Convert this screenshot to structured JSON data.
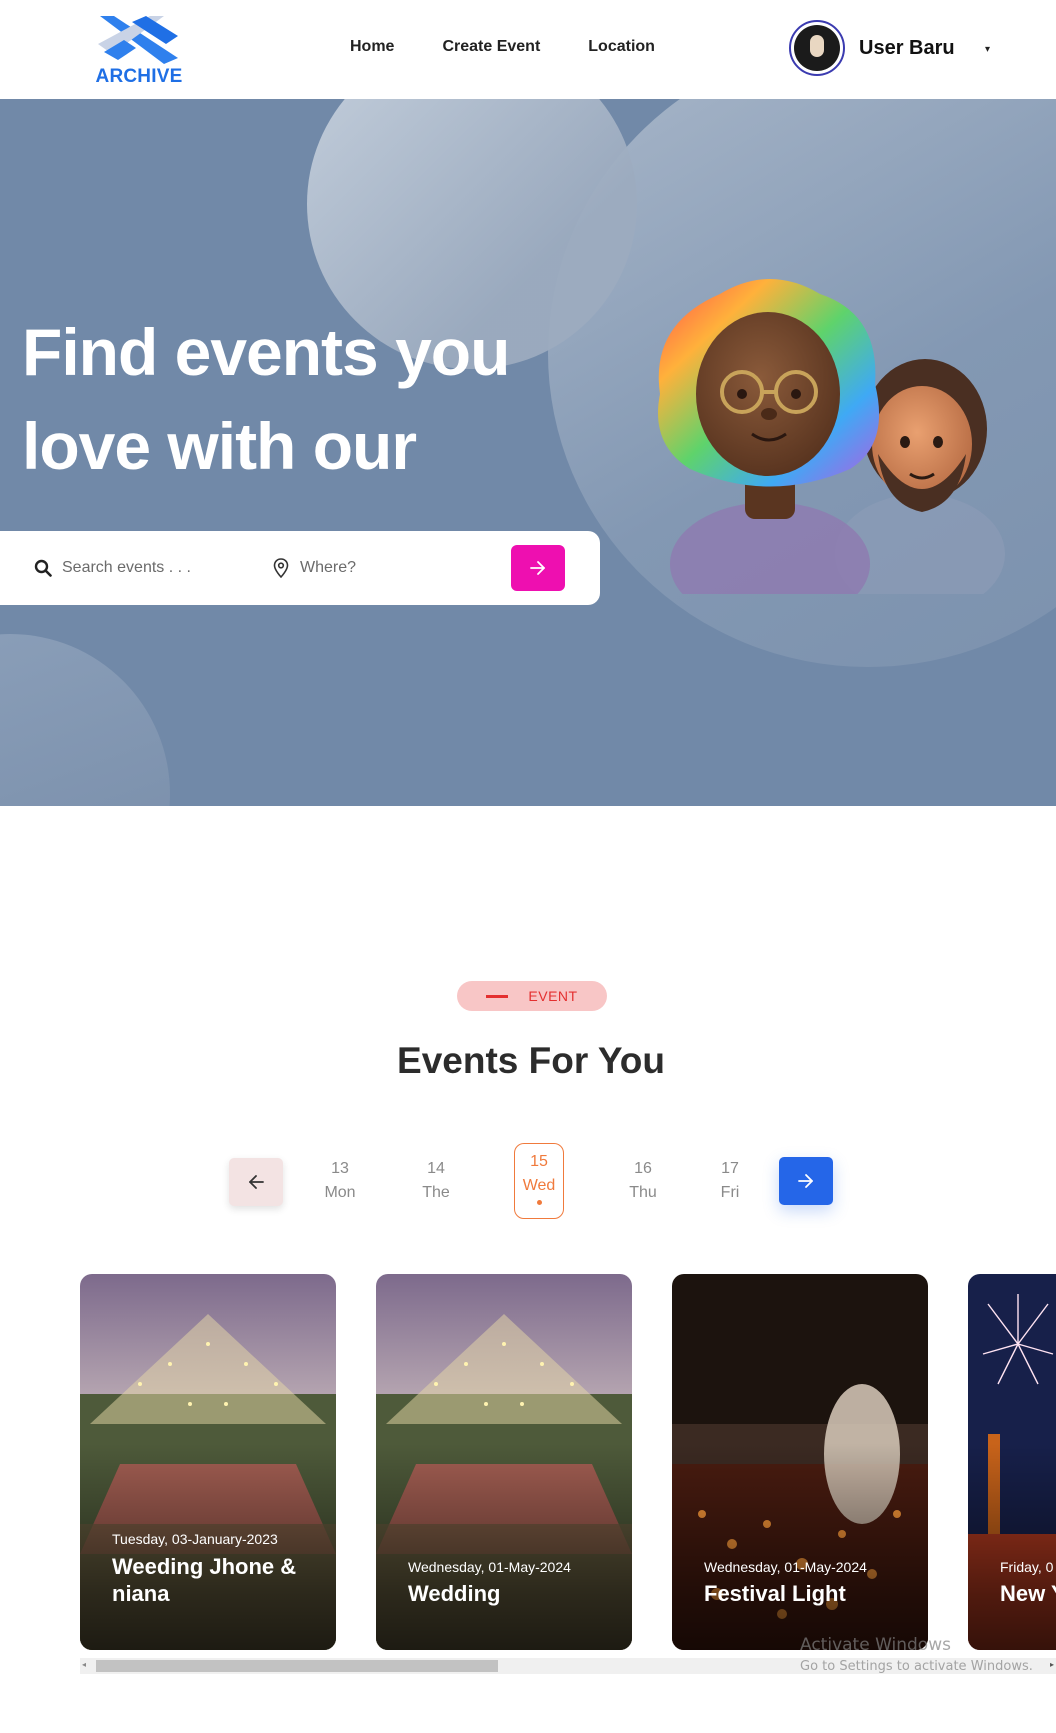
{
  "brand": {
    "logo_text": "ARCHIVE",
    "accent": "#1f6fe5"
  },
  "nav": {
    "items": [
      "Home",
      "Create Event",
      "Location"
    ]
  },
  "user": {
    "name": "User Baru",
    "menu_caret": "▾"
  },
  "hero": {
    "title_line1": "Find events you",
    "title_line2": "love with our",
    "background": "#7189a8"
  },
  "search": {
    "events_placeholder": "Search events . . .",
    "location_placeholder": "Where?",
    "button_color": "#ee0fb0"
  },
  "events_section": {
    "badge": "EVENT",
    "title": "Events For You",
    "days": [
      {
        "num": "13",
        "label": "Mon",
        "active": false
      },
      {
        "num": "14",
        "label": "The",
        "active": false
      },
      {
        "num": "15",
        "label": "Wed",
        "active": true
      },
      {
        "num": "16",
        "label": "Thu",
        "active": false
      },
      {
        "num": "17",
        "label": "Fri",
        "active": false
      }
    ],
    "cards": [
      {
        "date": "Tuesday, 03-January-2023",
        "title": "Weeding Jhone & niana"
      },
      {
        "date": "Wednesday, 01-May-2024",
        "title": "Wedding"
      },
      {
        "date": "Wednesday, 01-May-2024",
        "title": "Festival Light"
      },
      {
        "date": "Friday, 0",
        "title": "New Y"
      }
    ]
  },
  "os_watermark": {
    "line1": "Activate Windows",
    "line2": "Go to Settings to activate Windows."
  }
}
